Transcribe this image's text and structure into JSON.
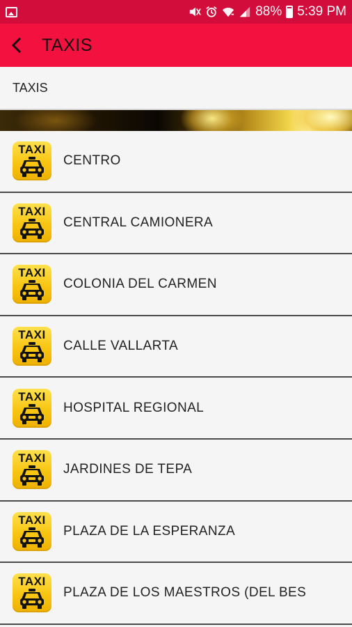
{
  "status_bar": {
    "battery": "88%",
    "time": "5:39 PM",
    "icons": [
      "gallery-icon",
      "mute-icon",
      "alarm-icon",
      "wifi-icon",
      "signal-icon"
    ]
  },
  "app_bar": {
    "title": "TAXIS",
    "back_icon": "chevron-left-icon",
    "background": "#f2113f"
  },
  "section": {
    "header": "TAXIS"
  },
  "taxi_icon": {
    "label": "TAXI",
    "color": "#f7c512"
  },
  "items": [
    {
      "label": "CENTRO"
    },
    {
      "label": "CENTRAL CAMIONERA"
    },
    {
      "label": "COLONIA DEL CARMEN"
    },
    {
      "label": "CALLE VALLARTA"
    },
    {
      "label": "HOSPITAL REGIONAL"
    },
    {
      "label": "JARDINES DE TEPA"
    },
    {
      "label": "PLAZA DE LA ESPERANZA"
    },
    {
      "label": "PLAZA DE LOS MAESTROS (DEL BES"
    }
  ]
}
